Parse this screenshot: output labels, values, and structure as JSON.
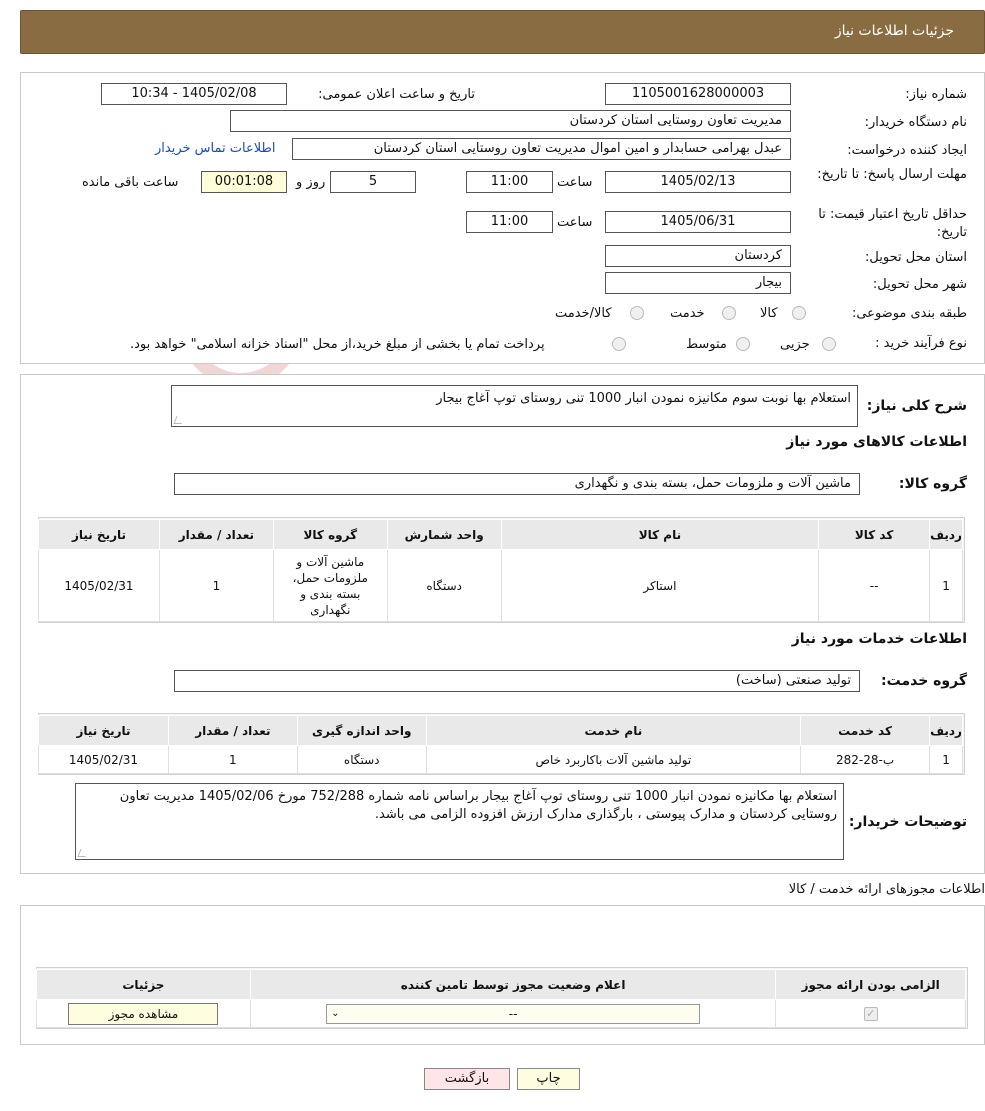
{
  "header": {
    "title": "جزئیات اطلاعات نیاز"
  },
  "watermark": {
    "text": "AriaTender.neT"
  },
  "info": {
    "need_number_label": "شماره نیاز:",
    "need_number": "1105001628000003",
    "announce_label": "تاریخ و ساعت اعلان عمومی:",
    "announce_value": "1405/02/08 - 10:34",
    "buyer_org_label": "نام دستگاه خریدار:",
    "buyer_org": "مدیریت تعاون روستایی استان کردستان",
    "creator_label": "ایجاد کننده درخواست:",
    "creator": "عبدل بهرامی حسابدار و امین اموال مدیریت تعاون روستایی استان کردستان",
    "contact_link": "اطلاعات تماس خریدار",
    "deadline_label": "مهلت ارسال پاسخ: تا تاریخ:",
    "deadline_date": "1405/02/13",
    "time_label": "ساعت",
    "deadline_time": "11:00",
    "days_value": "5",
    "days_label": "روز و",
    "remaining_value": "00:01:08",
    "remaining_label": "ساعت باقی مانده",
    "validity_label": "حداقل تاریخ اعتبار قیمت: تا تاریخ:",
    "validity_date": "1405/06/31",
    "validity_time": "11:00",
    "province_label": "استان محل تحویل:",
    "province": "کردستان",
    "city_label": "شهر محل تحویل:",
    "city": "بیجار",
    "category_label": "طبقه بندی موضوعی:",
    "category_options": [
      "کالا",
      "خدمت",
      "کالا/خدمت"
    ],
    "process_label": "نوع فرآیند خرید :",
    "process_options": [
      "جزیی",
      "متوسط"
    ],
    "process_note": "پرداخت تمام یا بخشی از مبلغ خرید،از محل \"اسناد خزانه اسلامی\" خواهد بود."
  },
  "description": {
    "label": "شرح کلی نیاز:",
    "text": "استعلام بها نوبت سوم مکانیزه نمودن انبار 1000 تنی روستای توپ آغاج بیجار"
  },
  "goods": {
    "section_title": "اطلاعات کالاهای مورد نیاز",
    "group_label": "گروه کالا:",
    "group_value": "ماشین آلات و ملزومات حمل، بسته بندی و نگهداری",
    "headers": [
      "ردیف",
      "کد کالا",
      "نام کالا",
      "واحد شمارش",
      "گروه کالا",
      "تعداد / مقدار",
      "تاریخ نیاز"
    ],
    "rows": [
      {
        "idx": "1",
        "code": "--",
        "name": "استاکر",
        "unit": "دستگاه",
        "group": "ماشین آلات و ملزومات حمل، بسته بندی و نگهداری",
        "qty": "1",
        "date": "1405/02/31"
      }
    ]
  },
  "services": {
    "section_title": "اطلاعات خدمات مورد نیاز",
    "group_label": "گروه خدمت:",
    "group_value": "تولید صنعتی (ساخت)",
    "headers": [
      "ردیف",
      "کد خدمت",
      "نام خدمت",
      "واحد اندازه گیری",
      "تعداد / مقدار",
      "تاریخ نیاز"
    ],
    "rows": [
      {
        "idx": "1",
        "code": "ب-28-282",
        "name": "تولید ماشین آلات باکاربرد خاص",
        "unit": "دستگاه",
        "qty": "1",
        "date": "1405/02/31"
      }
    ]
  },
  "buyer_notes": {
    "label": "توضیحات خریدار:",
    "text": "استعلام بها مکانیزه نمودن انبار 1000 تنی روستای توپ آغاج بیجار براساس نامه شماره 752/288 مورخ 1405/02/06 مدیریت تعاون روستایی کردستان و مدارک پیوستی ، بارگذاری مدارک ارزش افزوده الزامی می باشد."
  },
  "permits": {
    "title": "اطلاعات مجوزهای ارائه خدمت / کالا",
    "headers": [
      "الزامی بودن ارائه مجوز",
      "اعلام وضعیت مجوز توسط تامین کننده",
      "جزئیات"
    ],
    "select_value": "--",
    "view_button": "مشاهده مجوز"
  },
  "actions": {
    "print": "چاپ",
    "back": "بازگشت"
  }
}
